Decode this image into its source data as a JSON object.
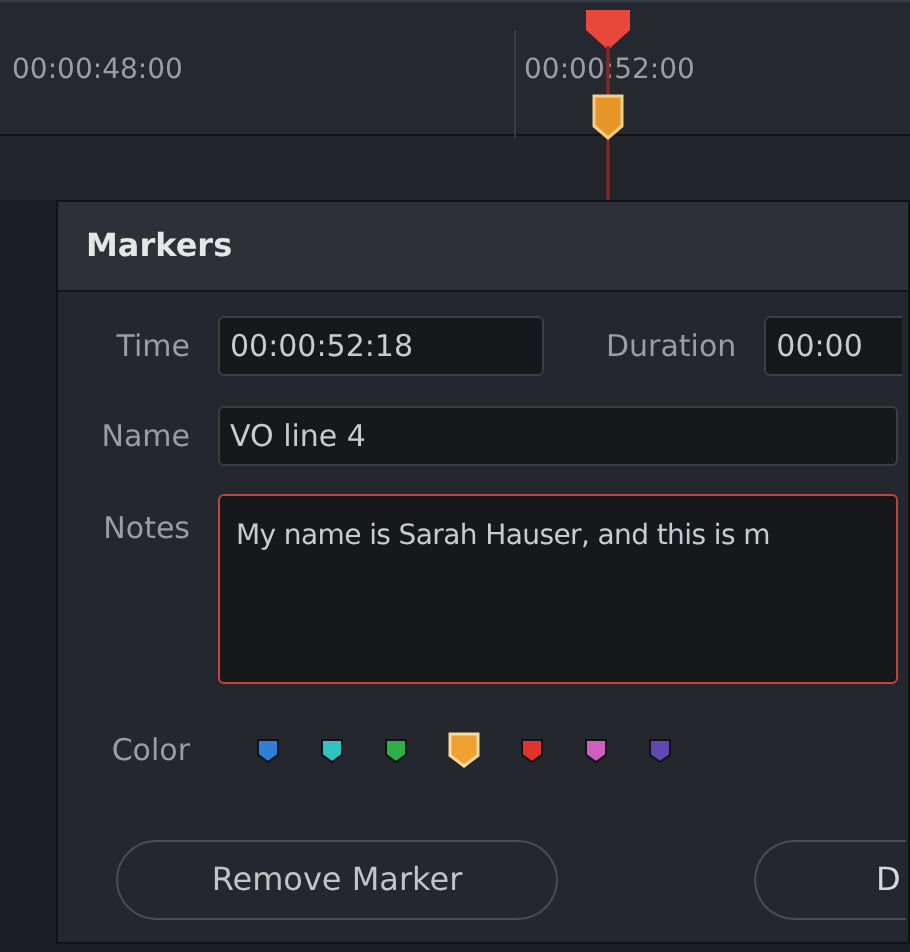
{
  "timeline": {
    "timecodes": [
      "00:00:48:00",
      "00:00:52:00"
    ]
  },
  "dialog": {
    "title": "Markers",
    "time": {
      "label": "Time",
      "value": "00:00:52:18"
    },
    "duration": {
      "label": "Duration",
      "value": "00:00"
    },
    "name": {
      "label": "Name",
      "value": "VO line 4"
    },
    "notes": {
      "label": "Notes",
      "value": "My name is Sarah Hauser, and this is m"
    },
    "color": {
      "label": "Color",
      "swatches": [
        {
          "color": "#2f7fd6",
          "selected": false
        },
        {
          "color": "#2fc4c4",
          "selected": false
        },
        {
          "color": "#2fae4a",
          "selected": false
        },
        {
          "color": "#f0a030",
          "selected": true
        },
        {
          "color": "#e0332b",
          "selected": false
        },
        {
          "color": "#d060c0",
          "selected": false
        },
        {
          "color": "#6048b0",
          "selected": false
        }
      ]
    },
    "buttons": [
      "Remove Marker",
      "D"
    ]
  }
}
